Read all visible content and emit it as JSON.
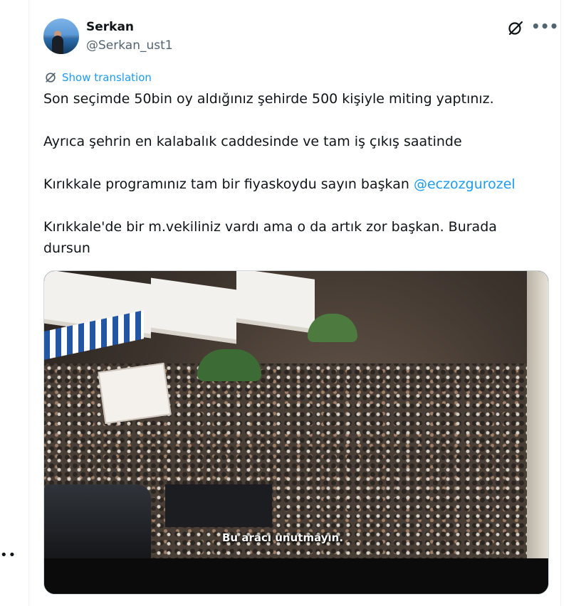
{
  "page": {
    "left_more": "••"
  },
  "tweet": {
    "author_name": "Serkan",
    "author_handle": "@Serkan_ust1",
    "show_translation_label": "Show translation",
    "more_icon_text": "•••",
    "paragraph_1": "Son seçimde 50bin oy aldığınız şehirde 500 kişiyle miting yaptınız.",
    "paragraph_2": "Ayrıca şehrin en kalabalık caddesinde ve tam iş çıkış saatinde",
    "paragraph_3_prefix": "Kırıkkale programınız tam bir fiyaskoydu sayın başkan ",
    "paragraph_3_mention": "@eczozgurozel",
    "paragraph_4": "Kırıkkale'de bir m.vekiliniz vardı ama o da artık zor başkan. Burada dursun",
    "video_caption": "Bu aracı unutmayın.",
    "colors": {
      "link": "#1d9bf0",
      "text": "#0f1419",
      "secondary": "#536471"
    },
    "icons": {
      "avatar": "profile-photo",
      "grok": "grok-icon",
      "more": "more-icon",
      "translate": "translate-icon"
    }
  }
}
